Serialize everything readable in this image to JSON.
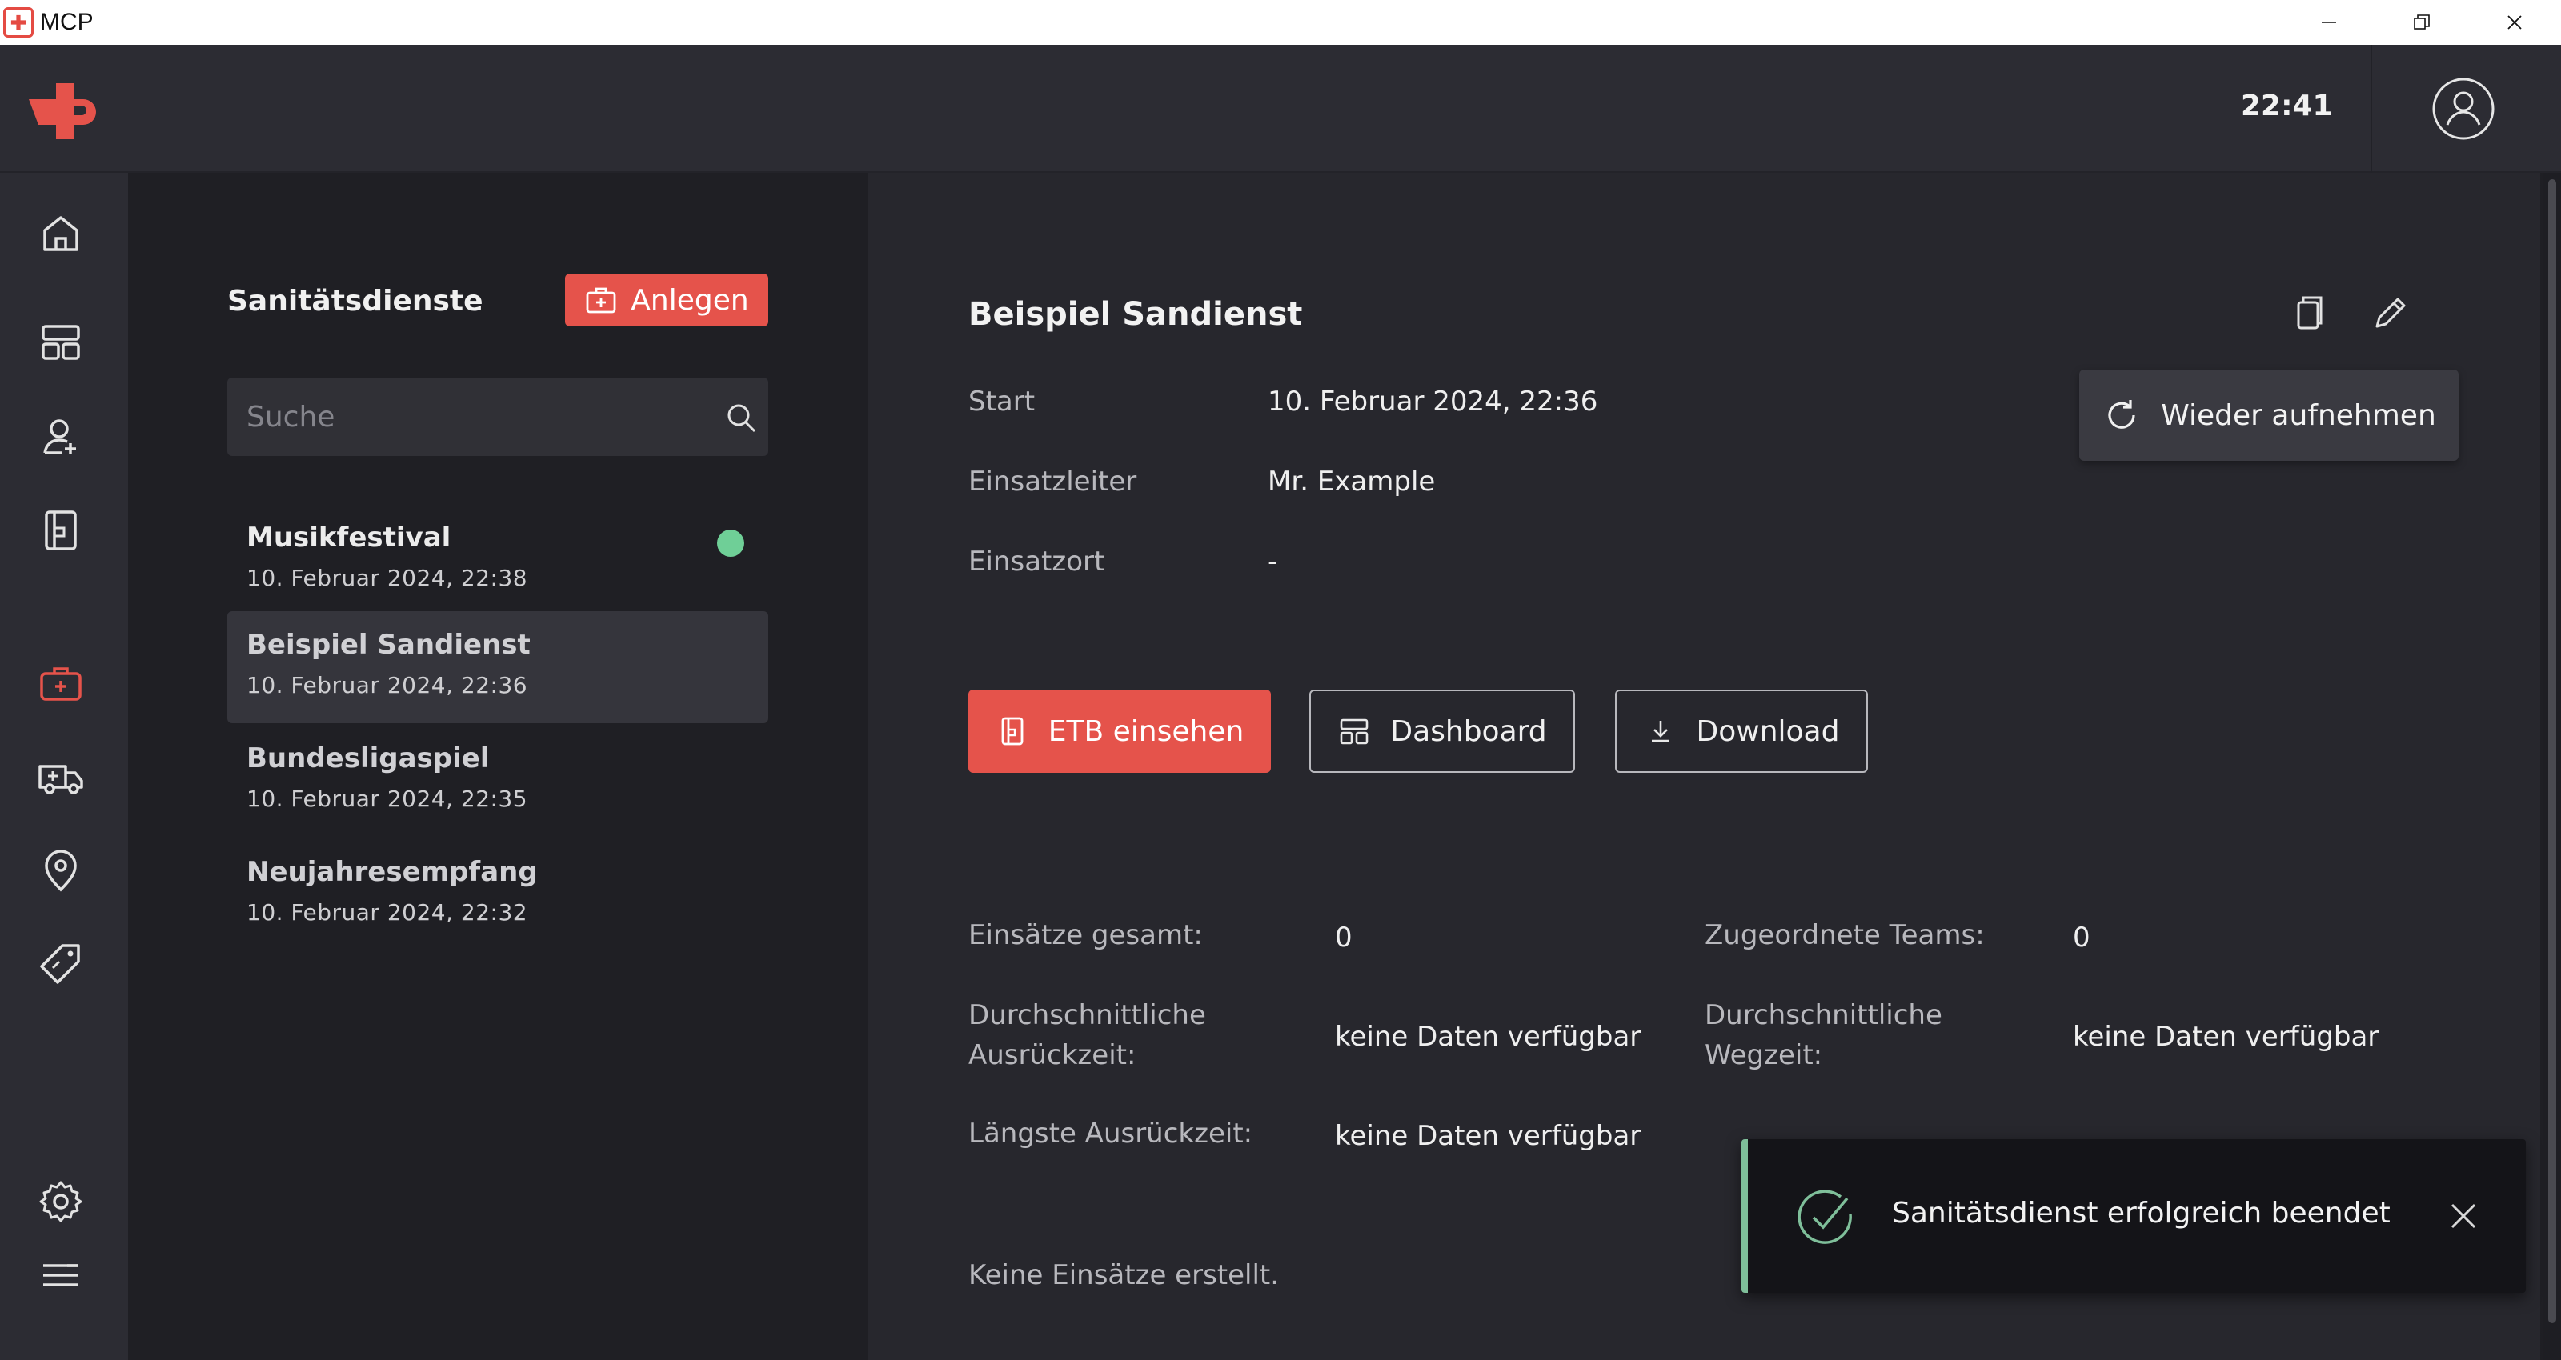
{
  "window": {
    "title": "MCP"
  },
  "header": {
    "time": "22:41"
  },
  "colors": {
    "accent": "#e5534b",
    "status_active": "#6fcf97",
    "toast_accent": "#7fbf9a"
  },
  "nav": {
    "items": [
      {
        "icon": "home-icon"
      },
      {
        "icon": "layout-icon"
      },
      {
        "icon": "user-add-icon"
      },
      {
        "icon": "logbook-icon"
      },
      {
        "icon": "medical-bag-icon",
        "active": true
      },
      {
        "icon": "ambulance-icon"
      },
      {
        "icon": "location-icon"
      },
      {
        "icon": "tag-icon"
      }
    ],
    "bottom": [
      {
        "icon": "gear-icon"
      },
      {
        "icon": "menu-icon"
      }
    ]
  },
  "list": {
    "title": "Sanitätsdienste",
    "create_label": "Anlegen",
    "search_placeholder": "Suche",
    "items": [
      {
        "name": "Musikfestival",
        "date": "10. Februar 2024, 22:38",
        "active_status": true
      },
      {
        "name": "Beispiel Sandienst",
        "date": "10. Februar 2024, 22:36",
        "selected": true
      },
      {
        "name": "Bundesligaspiel",
        "date": "10. Februar 2024, 22:35"
      },
      {
        "name": "Neujahresempfang",
        "date": "10. Februar 2024, 22:32"
      }
    ]
  },
  "detail": {
    "title": "Beispiel Sandienst",
    "fields": [
      {
        "label": "Start",
        "value": "10. Februar 2024, 22:36"
      },
      {
        "label": "Einsatzleiter",
        "value": "Mr. Example"
      },
      {
        "label": "Einsatzort",
        "value": "-"
      }
    ],
    "resume_label": "Wieder aufnehmen",
    "actions": {
      "etb": "ETB einsehen",
      "dashboard": "Dashboard",
      "download": "Download"
    },
    "stats": {
      "total_label": "Einsätze gesamt:",
      "total_value": "0",
      "teams_label": "Zugeordnete Teams:",
      "teams_value": "0",
      "avg_dispatch_label": "Durchschnittliche Ausrückzeit:",
      "avg_dispatch_value": "keine Daten verfügbar",
      "avg_route_label": "Durchschnittliche Wegzeit:",
      "avg_route_value": "keine Daten verfügbar",
      "longest_dispatch_label": "Längste Ausrückzeit:",
      "longest_dispatch_value": "keine Daten verfügbar"
    },
    "empty_note": "Keine Einsätze erstellt."
  },
  "toast": {
    "message": "Sanitätsdienst erfolgreich beendet"
  }
}
